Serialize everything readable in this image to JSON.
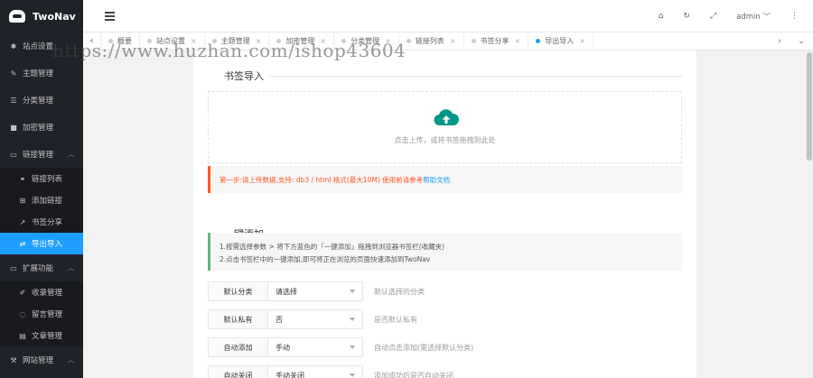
{
  "app": {
    "name": "TwoNav"
  },
  "sidebar": {
    "items": [
      {
        "label": "站点设置",
        "icon": "gear-icon"
      },
      {
        "label": "主题管理",
        "icon": "brush-icon"
      },
      {
        "label": "分类管理",
        "icon": "list-icon"
      },
      {
        "label": "加密管理",
        "icon": "lock-icon"
      },
      {
        "label": "链接管理",
        "icon": "folder-icon",
        "expanded": true
      }
    ],
    "link_sub": [
      {
        "label": "链接列表",
        "icon": "link-icon"
      },
      {
        "label": "添加链接",
        "icon": "plus-square-icon"
      },
      {
        "label": "书签分享",
        "icon": "share-icon"
      },
      {
        "label": "导出导入",
        "icon": "transfer-icon",
        "active": true
      }
    ],
    "ext": {
      "label": "扩展功能",
      "icon": "folder-icon"
    },
    "ext_sub": [
      {
        "label": "收录管理",
        "icon": "pen-icon"
      },
      {
        "label": "留言管理",
        "icon": "comment-icon"
      },
      {
        "label": "文章管理",
        "icon": "document-icon"
      }
    ],
    "bottom": {
      "label": "网站管理",
      "icon": "wrench-icon"
    }
  },
  "header": {
    "user": "admin"
  },
  "tabs": [
    {
      "label": "概要"
    },
    {
      "label": "站点设置"
    },
    {
      "label": "主题管理"
    },
    {
      "label": "加密管理"
    },
    {
      "label": "分类管理"
    },
    {
      "label": "链接列表"
    },
    {
      "label": "书签分享"
    },
    {
      "label": "导出导入",
      "active": true
    }
  ],
  "watermark": "https://www.huzhan.com/ishop43604",
  "import": {
    "title": "书签导入",
    "upload_text": "点击上传，或将书签拖拽到此处",
    "note_main": "第一步:请上传数据,支持: db3 / html 格式(最大10M) 使用前请参考",
    "note_link": "帮助文档",
    "note_tail": ""
  },
  "quickadd": {
    "title": "一键添加",
    "line1": "1.按需选择参数 > 将下方蓝色的「一键添加」拖拽到浏览器书签栏(收藏夹)",
    "line2": "2.点击书签栏中的一键添加,即可将正在浏览的页面快速添加到TwoNav"
  },
  "form": [
    {
      "label": "默认分类",
      "value": "请选择",
      "hint": "默认选择的分类"
    },
    {
      "label": "默认私有",
      "value": "否",
      "hint": "是否默认私有"
    },
    {
      "label": "自动添加",
      "value": "手动",
      "hint": "自动点击添加(需选择默认分类)"
    },
    {
      "label": "自动关闭",
      "value": "手动关闭",
      "hint": "添加成功后是否自动关闭"
    }
  ],
  "colors": {
    "accent": "#1e9fff",
    "sidebar": "#20222a",
    "warning": "#ff5722",
    "success": "#5fb878"
  }
}
